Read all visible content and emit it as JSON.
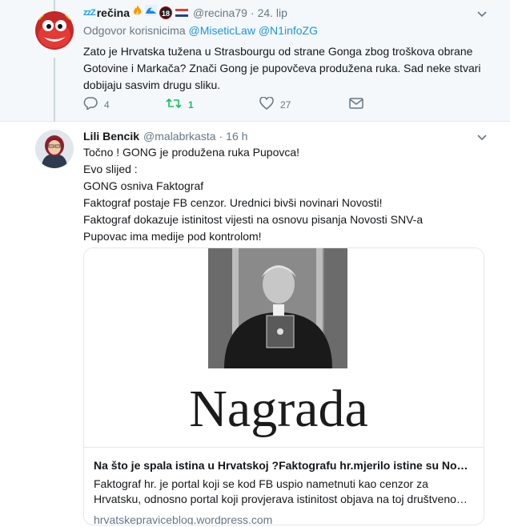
{
  "tweets": [
    {
      "name": "rečina",
      "name_prefix": "zzZ",
      "badge": "18",
      "handle": "@recina79",
      "time": "24. lip",
      "reply_label": "Odgovor korisnicima",
      "reply_mentions": [
        "@MiseticLaw",
        "@N1infoZG"
      ],
      "text_lines": [
        "Zato je Hrvatska tužena u Strasbourgu od strane Gonga zbog troškova obrane",
        "Gotovine i Markača? Znači Gong je pupovčeva produžena ruka. Sad neke stvari",
        "dobijaju sasvim drugu sliku."
      ],
      "actions": {
        "reply_count": "4",
        "retweet_count": "1",
        "like_count": "27"
      }
    },
    {
      "name": "Lili Bencik",
      "handle": "@malabrkasta",
      "time": "16 h",
      "text_lines": [
        "Točno ! GONG je produžena ruka Pupovca!",
        "Evo slijed :",
        "GONG osniva Faktograf",
        "Faktograf postaje  FB cenzor.  Urednici bivši novinari Novosti!",
        "Faktograf dokazuje istinitost vijesti na osnovu pisanja Novosti SNV-a",
        "Pupovac ima medije pod kontrolom!"
      ],
      "card": {
        "image_headline": "Nagrada",
        "title": "Na što je spala istina u Hrvatskoj ?Faktografu hr.mjerilo istine su No…",
        "description": "Faktograf hr. je portal koji se kod FB uspio nametnuti kao cenzor za Hrvatsku, odnosno portal koji provjerava istinitost objava na toj društveno…",
        "domain": "hrvatskepraviceblog.wordpress.com"
      }
    }
  ],
  "colors": {
    "link": "#1b95e0",
    "retweet_active": "#17bf63",
    "muted": "#657786"
  },
  "icons": [
    "chevron-down-icon",
    "reply-icon",
    "retweet-icon",
    "like-icon",
    "message-icon",
    "flame-icon",
    "wave-icon",
    "croatia-flag-icon"
  ]
}
